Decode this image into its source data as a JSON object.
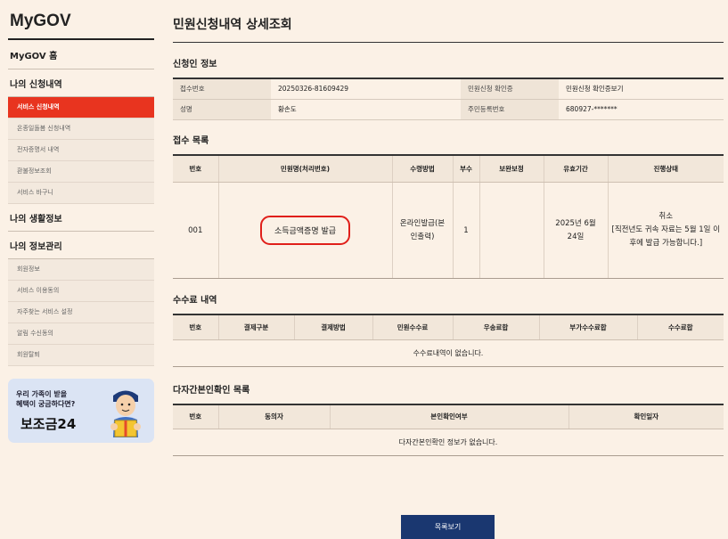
{
  "sidebar": {
    "brand": "MyGOV",
    "home": "MyGOV 홈",
    "sections": [
      {
        "label": "나의 신청내역",
        "items": [
          "서비스 신청내역",
          "온종일돌봄 신청내역",
          "전자증명서 내역",
          "환불정보조회",
          "서비스 바구니"
        ]
      },
      {
        "label": "나의 생활정보"
      },
      {
        "label": "나의 정보관리",
        "items": [
          "회원정보",
          "서비스 이용동의",
          "자주찾는 서비스 설정",
          "알림 수신동의",
          "회원탈퇴"
        ]
      }
    ],
    "promo": {
      "line1": "우리 가족이 받을",
      "line2": "혜택이 궁금하다면?",
      "brand": "보조금24"
    }
  },
  "page_title": "민원신청내역 상세조회",
  "applicant": {
    "title": "신청인 정보",
    "rows": [
      [
        "접수번호",
        "20250326-81609429",
        "민원신청 확인증",
        "민원신청 확인증보기"
      ],
      [
        "성명",
        "황손도",
        "주민등록번호",
        "680927-*******"
      ]
    ]
  },
  "receipts": {
    "title": "접수 목록",
    "headers": [
      "번호",
      "민원명(처리번호)",
      "수령방법",
      "부수",
      "보완보정",
      "유효기간",
      "진행상태"
    ],
    "row": {
      "no": "001",
      "name": "소득금액증명 발급",
      "method": "온라인발급(본인출력)",
      "copies": "1",
      "supplement": "",
      "validity": "2025년 6월24일",
      "status": "취소",
      "status_note": "[직전년도 귀속 자료는 5월 1일 이후에 발급 가능합니다.]"
    }
  },
  "fees": {
    "title": "수수료 내역",
    "headers": [
      "번호",
      "결제구분",
      "결제방법",
      "민원수수료",
      "우송료합",
      "부가수수료합",
      "수수료합"
    ],
    "empty": "수수료내역이 없습니다."
  },
  "identity": {
    "title": "다자간본인확인 목록",
    "headers": [
      "번호",
      "동의자",
      "본인확인여부",
      "확인일자"
    ],
    "empty": "다자간본인확인 정보가 없습니다."
  },
  "list_button": "목록보기",
  "colors": {
    "accent": "#e8341f",
    "button": "#1a3770",
    "background": "#fbf1e6"
  }
}
